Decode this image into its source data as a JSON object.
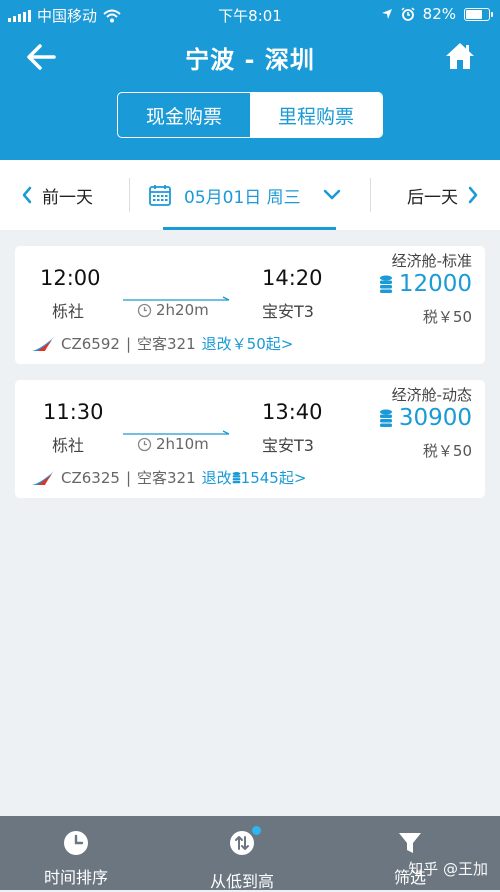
{
  "status_bar": {
    "carrier": "中国移动",
    "time": "下午8:01",
    "battery": "82%",
    "battery_level": 0.82
  },
  "header": {
    "title": "宁波 - 深圳",
    "seg_cash": "现金购票",
    "seg_miles": "里程购票",
    "selected": "里程购票"
  },
  "datebar": {
    "prev": "前一天",
    "date": "05月01日 周三",
    "next": "后一天"
  },
  "flights": [
    {
      "depart_time": "12:00",
      "depart_airport": "栎社",
      "arrive_time": "14:20",
      "arrive_airport": "宝安T3",
      "duration": "2h20m",
      "cabin": "经济舱-标准",
      "miles": "12000",
      "tax": "税￥50",
      "flight_no": "CZ6592",
      "aircraft": "空客321",
      "refund_label": "退改",
      "refund_value": "￥50起>"
    },
    {
      "depart_time": "11:30",
      "depart_airport": "栎社",
      "arrive_time": "13:40",
      "arrive_airport": "宝安T3",
      "duration": "2h10m",
      "cabin": "经济舱-动态",
      "miles": "30900",
      "tax": "税￥50",
      "flight_no": "CZ6325",
      "aircraft": "空客321",
      "refund_label": "退改",
      "refund_value": "1545起>"
    }
  ],
  "bottom_bar": {
    "tab_time": "时间排序",
    "tab_price": "从低到高",
    "tab_filter": "筛选",
    "watermark": "知乎 @王加"
  },
  "colors": {
    "brand": "#1a9ad6",
    "bottom_bar": "#6b7680",
    "background": "#eef1f4"
  }
}
